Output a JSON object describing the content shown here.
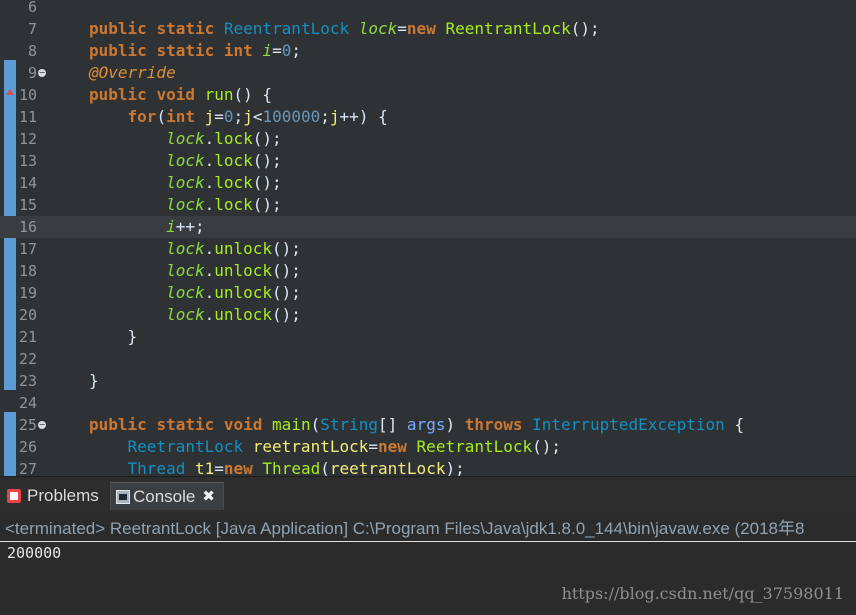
{
  "editor": {
    "lines": [
      {
        "num": "6",
        "tokens": [],
        "fold": false,
        "override": false,
        "current": false
      },
      {
        "num": "7",
        "tokens": [
          [
            "kw",
            "public"
          ],
          [
            "plain",
            " "
          ],
          [
            "kw",
            "static"
          ],
          [
            "plain",
            " "
          ],
          [
            "type",
            "ReentrantLock"
          ],
          [
            "plain",
            " "
          ],
          [
            "fieldI",
            "lock"
          ],
          [
            "plain",
            "="
          ],
          [
            "kw",
            "new"
          ],
          [
            "plain",
            " "
          ],
          [
            "method",
            "ReentrantLock"
          ],
          [
            "plain",
            "();"
          ]
        ],
        "fold": false,
        "override": false,
        "current": false
      },
      {
        "num": "8",
        "tokens": [
          [
            "kw",
            "public"
          ],
          [
            "plain",
            " "
          ],
          [
            "kw",
            "static"
          ],
          [
            "plain",
            " "
          ],
          [
            "kw",
            "int"
          ],
          [
            "plain",
            " "
          ],
          [
            "fieldI",
            "i"
          ],
          [
            "plain",
            "="
          ],
          [
            "num",
            "0"
          ],
          [
            "plain",
            ";"
          ]
        ],
        "fold": false,
        "override": false,
        "current": false
      },
      {
        "num": "9",
        "tokens": [
          [
            "ann",
            "@Override"
          ]
        ],
        "fold": true,
        "override": false,
        "current": false
      },
      {
        "num": "10",
        "tokens": [
          [
            "kw",
            "public"
          ],
          [
            "plain",
            " "
          ],
          [
            "kw",
            "void"
          ],
          [
            "plain",
            " "
          ],
          [
            "method",
            "run"
          ],
          [
            "plain",
            "() {"
          ]
        ],
        "fold": false,
        "override": true,
        "current": false
      },
      {
        "num": "11",
        "tokens": [
          [
            "plain",
            "    "
          ],
          [
            "kw",
            "for"
          ],
          [
            "plain",
            "("
          ],
          [
            "kw",
            "int"
          ],
          [
            "plain",
            " "
          ],
          [
            "var",
            "j"
          ],
          [
            "plain",
            "="
          ],
          [
            "num",
            "0"
          ],
          [
            "plain",
            ";"
          ],
          [
            "var",
            "j"
          ],
          [
            "plain",
            "<"
          ],
          [
            "num",
            "100000"
          ],
          [
            "plain",
            ";"
          ],
          [
            "var",
            "j"
          ],
          [
            "plain",
            "++) {"
          ]
        ],
        "fold": false,
        "override": false,
        "current": false
      },
      {
        "num": "12",
        "tokens": [
          [
            "plain",
            "        "
          ],
          [
            "fieldI",
            "lock"
          ],
          [
            "plain",
            "."
          ],
          [
            "method",
            "lock"
          ],
          [
            "plain",
            "();"
          ]
        ],
        "fold": false,
        "override": false,
        "current": false
      },
      {
        "num": "13",
        "tokens": [
          [
            "plain",
            "        "
          ],
          [
            "fieldI",
            "lock"
          ],
          [
            "plain",
            "."
          ],
          [
            "method",
            "lock"
          ],
          [
            "plain",
            "();"
          ]
        ],
        "fold": false,
        "override": false,
        "current": false
      },
      {
        "num": "14",
        "tokens": [
          [
            "plain",
            "        "
          ],
          [
            "fieldI",
            "lock"
          ],
          [
            "plain",
            "."
          ],
          [
            "method",
            "lock"
          ],
          [
            "plain",
            "();"
          ]
        ],
        "fold": false,
        "override": false,
        "current": false
      },
      {
        "num": "15",
        "tokens": [
          [
            "plain",
            "        "
          ],
          [
            "fieldI",
            "lock"
          ],
          [
            "plain",
            "."
          ],
          [
            "method",
            "lock"
          ],
          [
            "plain",
            "();"
          ]
        ],
        "fold": false,
        "override": false,
        "current": false
      },
      {
        "num": "16",
        "tokens": [
          [
            "plain",
            "        "
          ],
          [
            "fieldI",
            "i"
          ],
          [
            "plain",
            "++;"
          ]
        ],
        "fold": false,
        "override": false,
        "current": true
      },
      {
        "num": "17",
        "tokens": [
          [
            "plain",
            "        "
          ],
          [
            "fieldI",
            "lock"
          ],
          [
            "plain",
            "."
          ],
          [
            "method",
            "unlock"
          ],
          [
            "plain",
            "();"
          ]
        ],
        "fold": false,
        "override": false,
        "current": false
      },
      {
        "num": "18",
        "tokens": [
          [
            "plain",
            "        "
          ],
          [
            "fieldI",
            "lock"
          ],
          [
            "plain",
            "."
          ],
          [
            "method",
            "unlock"
          ],
          [
            "plain",
            "();"
          ]
        ],
        "fold": false,
        "override": false,
        "current": false
      },
      {
        "num": "19",
        "tokens": [
          [
            "plain",
            "        "
          ],
          [
            "fieldI",
            "lock"
          ],
          [
            "plain",
            "."
          ],
          [
            "method",
            "unlock"
          ],
          [
            "plain",
            "();"
          ]
        ],
        "fold": false,
        "override": false,
        "current": false
      },
      {
        "num": "20",
        "tokens": [
          [
            "plain",
            "        "
          ],
          [
            "fieldI",
            "lock"
          ],
          [
            "plain",
            "."
          ],
          [
            "method",
            "unlock"
          ],
          [
            "plain",
            "();"
          ]
        ],
        "fold": false,
        "override": false,
        "current": false
      },
      {
        "num": "21",
        "tokens": [
          [
            "plain",
            "    }"
          ]
        ],
        "fold": false,
        "override": false,
        "current": false
      },
      {
        "num": "22",
        "tokens": [],
        "fold": false,
        "override": false,
        "current": false
      },
      {
        "num": "23",
        "tokens": [
          [
            "plain",
            "}"
          ]
        ],
        "fold": false,
        "override": false,
        "current": false
      },
      {
        "num": "24",
        "tokens": [],
        "fold": false,
        "override": false,
        "current": false
      },
      {
        "num": "25",
        "tokens": [
          [
            "kw",
            "public"
          ],
          [
            "plain",
            " "
          ],
          [
            "kw",
            "static"
          ],
          [
            "plain",
            " "
          ],
          [
            "kw",
            "void"
          ],
          [
            "plain",
            " "
          ],
          [
            "method",
            "main"
          ],
          [
            "plain",
            "("
          ],
          [
            "type",
            "String"
          ],
          [
            "plain",
            "[] "
          ],
          [
            "param",
            "args"
          ],
          [
            "plain",
            ") "
          ],
          [
            "kw",
            "throws"
          ],
          [
            "plain",
            " "
          ],
          [
            "type",
            "InterruptedException"
          ],
          [
            "plain",
            " {"
          ]
        ],
        "fold": true,
        "override": false,
        "current": false
      },
      {
        "num": "26",
        "tokens": [
          [
            "plain",
            "    "
          ],
          [
            "type",
            "ReetrantLock"
          ],
          [
            "plain",
            " "
          ],
          [
            "var",
            "reetrantLock"
          ],
          [
            "plain",
            "="
          ],
          [
            "kw",
            "new"
          ],
          [
            "plain",
            " "
          ],
          [
            "method",
            "ReetrantLock"
          ],
          [
            "plain",
            "();"
          ]
        ],
        "fold": false,
        "override": false,
        "current": false
      },
      {
        "num": "27",
        "tokens": [
          [
            "plain",
            "    "
          ],
          [
            "type",
            "Thread"
          ],
          [
            "plain",
            " "
          ],
          [
            "var",
            "t1"
          ],
          [
            "plain",
            "="
          ],
          [
            "kw",
            "new"
          ],
          [
            "plain",
            " "
          ],
          [
            "method",
            "Thread"
          ],
          [
            "plain",
            "("
          ],
          [
            "var",
            "reetrantLock"
          ],
          [
            "plain",
            ");"
          ]
        ],
        "fold": false,
        "override": false,
        "current": false
      }
    ]
  },
  "tabs": {
    "problems_label": "Problems",
    "console_label": "Console",
    "close_glyph": "✖"
  },
  "console": {
    "header": "<terminated> ReetrantLock [Java Application] C:\\Program Files\\Java\\jdk1.8.0_144\\bin\\javaw.exe (2018年8",
    "output": "200000",
    "watermark": "https://blog.csdn.net/qq_37598011"
  },
  "colors": {
    "editor_bg": "#2f3234",
    "keyword": "#cc7832",
    "type": "#1290c3",
    "field": "#8dda3f",
    "method": "#a7ec21",
    "number": "#6897bb",
    "variable": "#f3ec79",
    "parameter": "#79abff",
    "annotation": "#e08f34",
    "console_header": "#8fa3b4"
  }
}
